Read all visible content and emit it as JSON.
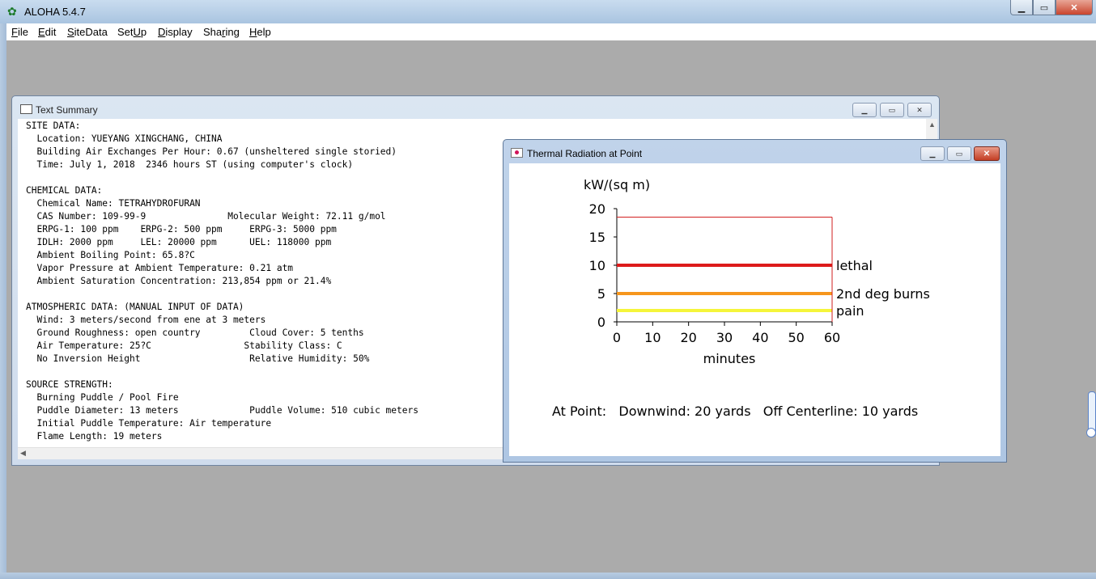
{
  "app": {
    "title": "ALOHA 5.4.7",
    "menu": [
      {
        "pre": "",
        "ul": "F",
        "post": "ile"
      },
      {
        "pre": "",
        "ul": "E",
        "post": "dit"
      },
      {
        "pre": "",
        "ul": "S",
        "post": "iteData"
      },
      {
        "pre": "Set",
        "ul": "U",
        "post": "p"
      },
      {
        "pre": "",
        "ul": "D",
        "post": "isplay"
      },
      {
        "pre": "Sha",
        "ul": "r",
        "post": "ing"
      },
      {
        "pre": "",
        "ul": "H",
        "post": "elp"
      }
    ]
  },
  "text_summary": {
    "title": "Text Summary",
    "lines": [
      "SITE DATA:",
      "  Location: YUEYANG XINGCHANG, CHINA",
      "  Building Air Exchanges Per Hour: 0.67 (unsheltered single storied)",
      "  Time: July 1, 2018  2346 hours ST (using computer's clock)",
      "",
      "CHEMICAL DATA:",
      "  Chemical Name: TETRAHYDROFURAN",
      "  CAS Number: 109-99-9               Molecular Weight: 72.11 g/mol",
      "  ERPG-1: 100 ppm    ERPG-2: 500 ppm     ERPG-3: 5000 ppm",
      "  IDLH: 2000 ppm     LEL: 20000 ppm      UEL: 118000 ppm",
      "  Ambient Boiling Point: 65.8?C",
      "  Vapor Pressure at Ambient Temperature: 0.21 atm",
      "  Ambient Saturation Concentration: 213,854 ppm or 21.4%",
      "",
      "ATMOSPHERIC DATA: (MANUAL INPUT OF DATA)",
      "  Wind: 3 meters/second from ene at 3 meters",
      "  Ground Roughness: open country         Cloud Cover: 5 tenths",
      "  Air Temperature: 25?C                 Stability Class: C",
      "  No Inversion Height                    Relative Humidity: 50%",
      "",
      "SOURCE STRENGTH:",
      "  Burning Puddle / Pool Fire",
      "  Puddle Diameter: 13 meters             Puddle Volume: 510 cubic meters",
      "  Initial Puddle Temperature: Air temperature",
      "  Flame Length: 19 meters"
    ]
  },
  "thermal": {
    "title": "Thermal Radiation at Point",
    "footer": "At Point:   Downwind: 20 yards   Off Centerline: 10 yards"
  },
  "chart_data": {
    "type": "line",
    "ylabel": "kW/(sq m)",
    "xlabel": "minutes",
    "x_ticks": [
      0,
      10,
      20,
      30,
      40,
      50,
      60
    ],
    "y_ticks": [
      0,
      5,
      10,
      15,
      20
    ],
    "xlim": [
      0,
      60
    ],
    "ylim": [
      0,
      20
    ],
    "series": [
      {
        "name": "point",
        "x": [
          0,
          60
        ],
        "values": [
          18.5,
          18.5
        ],
        "color": "#d21f1f"
      }
    ],
    "thresholds": [
      {
        "name": "lethal",
        "value": 10,
        "color": "#dd1a1a"
      },
      {
        "name": "2nd deg burns",
        "value": 5,
        "color": "#f6961c"
      },
      {
        "name": "pain",
        "value": 2,
        "color": "#f5f53a"
      }
    ]
  }
}
